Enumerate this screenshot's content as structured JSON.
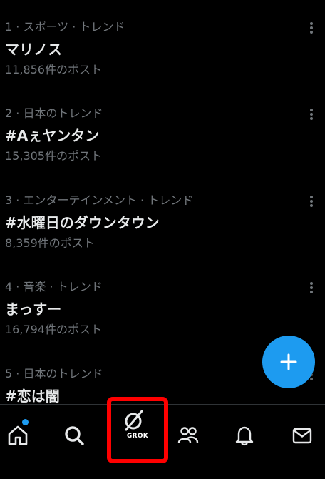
{
  "trends": [
    {
      "meta": "1 · スポーツ · トレンド",
      "name": "マリノス",
      "count": "11,856件のポスト"
    },
    {
      "meta": "2 · 日本のトレンド",
      "name": "#Aぇヤンタン",
      "count": "15,305件のポスト"
    },
    {
      "meta": "3 · エンターテインメント · トレンド",
      "name": "#水曜日のダウンタウン",
      "count": "8,359件のポスト"
    },
    {
      "meta": "4 · 音楽 · トレンド",
      "name": "まっすー",
      "count": "16,794件のポスト"
    },
    {
      "meta": "5 · 日本のトレンド",
      "name": "#恋は闇",
      "count": ""
    }
  ],
  "fab": {
    "icon": "plus-icon"
  },
  "bottom_nav": {
    "items": [
      {
        "icon": "home-icon",
        "has_badge": true
      },
      {
        "icon": "search-icon"
      },
      {
        "icon": "grok-icon",
        "label": "GROK",
        "highlighted": true
      },
      {
        "icon": "communities-icon"
      },
      {
        "icon": "bell-icon"
      },
      {
        "icon": "mail-icon"
      }
    ]
  },
  "colors": {
    "background": "#000000",
    "primary_text": "#e7e9ea",
    "secondary_text": "#71767b",
    "accent": "#1d9bf0",
    "highlight_box": "#ff0000"
  }
}
